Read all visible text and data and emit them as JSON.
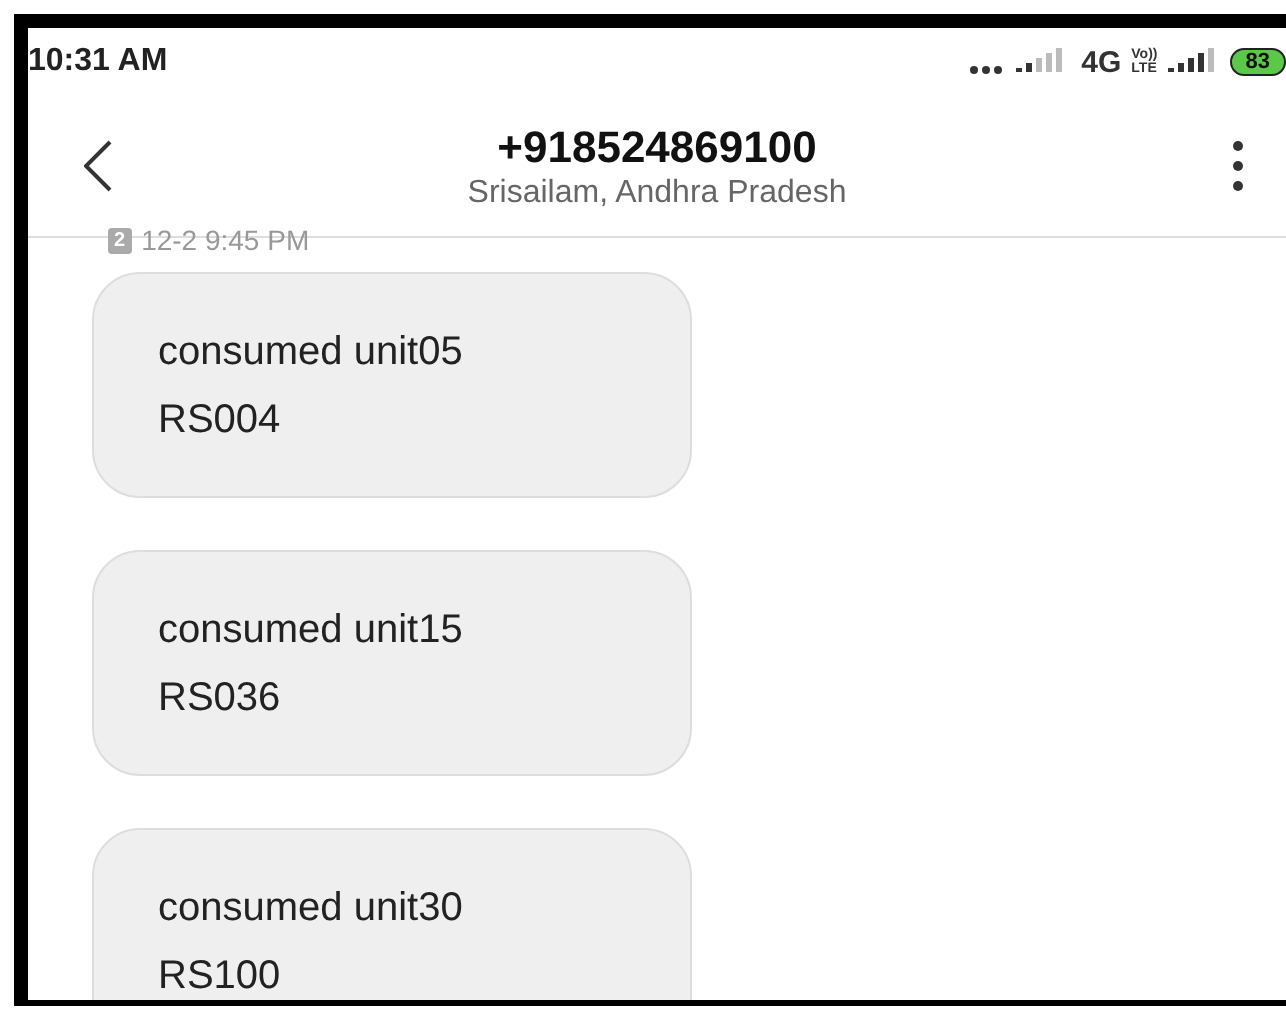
{
  "status_bar": {
    "time": "10:31 AM",
    "network": "4G",
    "volte_top": "Vo))",
    "volte_bottom": "LTE",
    "battery": "83"
  },
  "header": {
    "title": "+918524869100",
    "subtitle": "Srisailam, Andhra Pradesh"
  },
  "timestamp": {
    "sim": "2",
    "time": "12-2 9:45 PM"
  },
  "messages": [
    {
      "lines": [
        "consumed unit05",
        "RS004"
      ]
    },
    {
      "lines": [
        "consumed unit15",
        "RS036"
      ]
    },
    {
      "lines": [
        "consumed unit30",
        "RS100"
      ]
    }
  ]
}
